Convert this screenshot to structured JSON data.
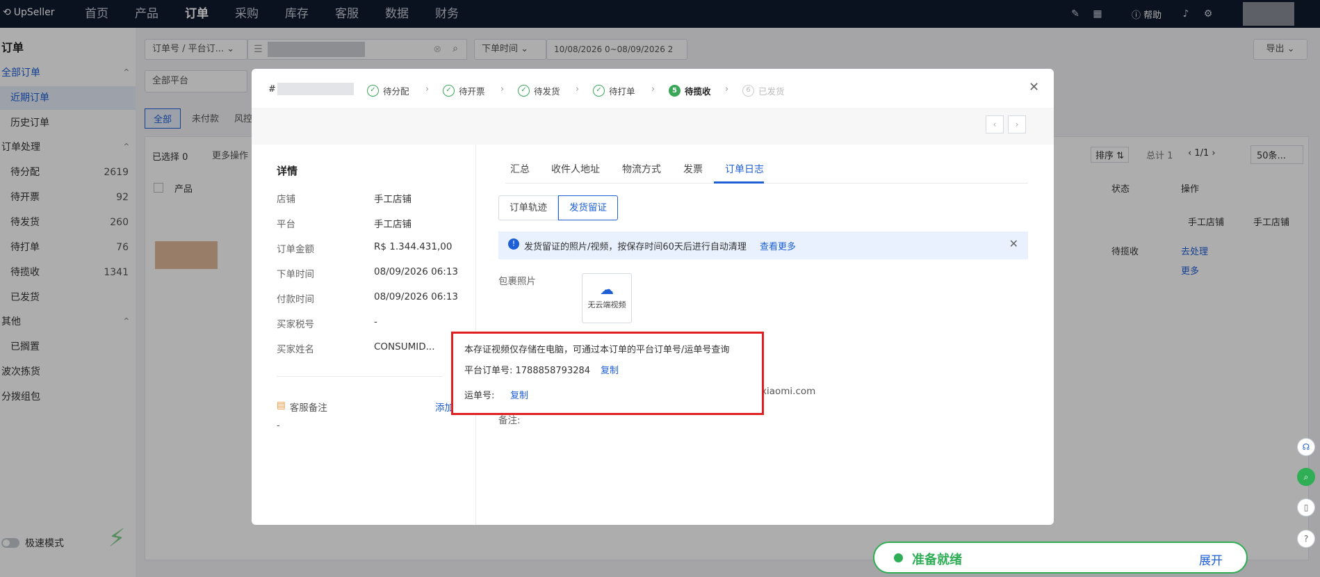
{
  "topbar": {
    "logo": "UpSeller",
    "nav": [
      "首页",
      "产品",
      "订单",
      "采购",
      "库存",
      "客服",
      "数据",
      "财务"
    ],
    "active_index": 2,
    "help": "帮助"
  },
  "sidebar": {
    "title": "订单",
    "sections": [
      {
        "label": "全部订单"
      },
      {
        "label": "近期订单"
      },
      {
        "label": "历史订单"
      },
      {
        "label": "订单处理"
      },
      {
        "label": "待分配",
        "count": "2619"
      },
      {
        "label": "待开票",
        "count": "92"
      },
      {
        "label": "待发货",
        "count": "260"
      },
      {
        "label": "待打单",
        "count": "76"
      },
      {
        "label": "待揽收",
        "count": "1341"
      },
      {
        "label": "已发货"
      },
      {
        "label": "其他"
      },
      {
        "label": "已搁置"
      },
      {
        "label": "波次拣货"
      },
      {
        "label": "分拨组包"
      }
    ],
    "fast_mode": "极速模式"
  },
  "filters": {
    "search_type": "订单号 / 平台订...",
    "time_type": "下单时间",
    "date_range": "10/08/2026 0~08/09/2026 2",
    "platform": "全部平台",
    "export": "导出"
  },
  "status_tabs": [
    "全部",
    "未付款",
    "风控"
  ],
  "list": {
    "selected": "已选择 0",
    "more_actions": "更多操作",
    "sort": "排序",
    "total": "总计 1",
    "page": "1/1",
    "per_page": "50条...",
    "col_product": "产品",
    "col_status": "状态",
    "col_action": "操作",
    "shop1": "手工店铺",
    "shop2": "手工店铺",
    "row_status": "待揽收",
    "row_action": "去处理",
    "row_more": "更多"
  },
  "modal": {
    "order_prefix": "#",
    "steps": [
      {
        "label": "待分配",
        "state": "done"
      },
      {
        "label": "待开票",
        "state": "done"
      },
      {
        "label": "待发货",
        "state": "done"
      },
      {
        "label": "待打单",
        "state": "done"
      },
      {
        "label": "待揽收",
        "state": "current",
        "num": "5"
      },
      {
        "label": "已发货",
        "state": "todo",
        "num": "6"
      }
    ],
    "details_title": "详情",
    "details": [
      {
        "k": "店铺",
        "v": "手工店铺"
      },
      {
        "k": "平台",
        "v": "手工店铺"
      },
      {
        "k": "订单金额",
        "v": "R$ 1.344.431,00"
      },
      {
        "k": "下单时间",
        "v": "08/09/2026 06:13"
      },
      {
        "k": "付款时间",
        "v": "08/09/2026 06:13"
      },
      {
        "k": "买家税号",
        "v": "-"
      },
      {
        "k": "买家姓名",
        "v": "CONSUMID..."
      }
    ],
    "service_note": "客服备注",
    "add_label": "添加",
    "note_value": "-",
    "tabs": [
      "汇总",
      "收件人地址",
      "物流方式",
      "发票",
      "订单日志"
    ],
    "active_tab": 4,
    "subtabs": [
      "订单轨迹",
      "发货留证"
    ],
    "info_text": "发货留证的照片/视频，按保存时间60天后进行自动清理",
    "info_link": "查看更多",
    "package_photo": "包裹照片",
    "no_video": "无云端视频",
    "email_fragment": "xiaomi.com",
    "remark": "备注:"
  },
  "popup": {
    "notice": "本存证视频仅存储在电脑，可通过本订单的平台订单号/运单号查询",
    "platform_order_label": "平台订单号: 1788858793284",
    "copy1": "复制",
    "waybill_label": "运单号:",
    "copy2": "复制"
  },
  "ready": {
    "status": "准备就绪",
    "expand": "展开",
    "color": "#2fae56"
  },
  "colors": {
    "topbar": "#101a2e",
    "accent": "#1e5fd6",
    "success": "#3aa658",
    "highlight": "#e02020"
  }
}
